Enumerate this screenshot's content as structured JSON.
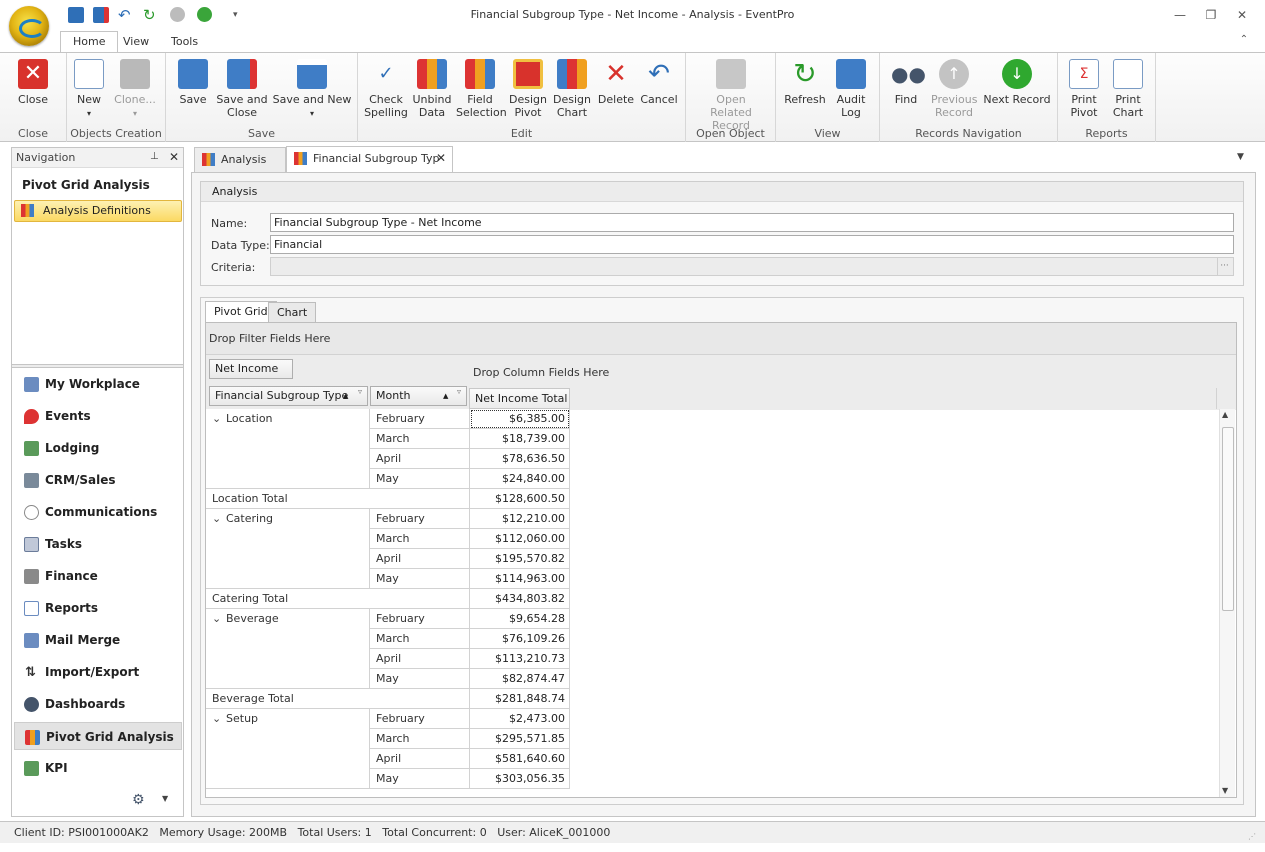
{
  "window": {
    "title": "Financial Subgroup Type - Net Income - Analysis - EventPro"
  },
  "ribbon_tabs": [
    "Home",
    "View",
    "Tools"
  ],
  "ribbon_groups": [
    {
      "name": "Close",
      "buttons": [
        "Close"
      ]
    },
    {
      "name": "Objects Creation",
      "buttons": [
        "New",
        "Clone..."
      ]
    },
    {
      "name": "Save",
      "buttons": [
        "Save",
        "Save and Close",
        "Save and New"
      ]
    },
    {
      "name": "Edit",
      "buttons": [
        "Check Spelling",
        "Unbind Data",
        "Field Selection",
        "Design Pivot",
        "Design Chart",
        "Delete",
        "Cancel"
      ]
    },
    {
      "name": "Open Object",
      "buttons": [
        "Open Related Record"
      ]
    },
    {
      "name": "View",
      "buttons": [
        "Refresh",
        "Audit Log"
      ]
    },
    {
      "name": "Records Navigation",
      "buttons": [
        "Find",
        "Previous Record",
        "Next Record"
      ]
    },
    {
      "name": "Reports",
      "buttons": [
        "Print Pivot",
        "Print Chart"
      ]
    }
  ],
  "navigation": {
    "header": "Navigation",
    "section_title": "Pivot Grid Analysis",
    "selected_item": "Analysis Definitions",
    "modules": [
      "My Workplace",
      "Events",
      "Lodging",
      "CRM/Sales",
      "Communications",
      "Tasks",
      "Finance",
      "Reports",
      "Mail Merge",
      "Import/Export",
      "Dashboards",
      "Pivot Grid Analysis",
      "KPI"
    ]
  },
  "doc_tabs": [
    "Analysis",
    "Financial Subgroup Typ"
  ],
  "analysis": {
    "section": "Analysis",
    "name_label": "Name:",
    "name_value": "Financial Subgroup Type - Net Income",
    "datatype_label": "Data Type:",
    "datatype_value": "Financial",
    "criteria_label": "Criteria:",
    "criteria_btn": "···"
  },
  "pivot": {
    "tabs": [
      "Pivot Grid",
      "Chart"
    ],
    "filter_area": "Drop Filter Fields Here",
    "data_field": "Net Income",
    "column_area": "Drop Column Fields Here",
    "row_fields": [
      "Financial Subgroup Type",
      "Month"
    ],
    "value_header": "Net Income Total",
    "groups": [
      {
        "name": "Location",
        "rows": [
          [
            "February",
            "$6,385.00"
          ],
          [
            "March",
            "$18,739.00"
          ],
          [
            "April",
            "$78,636.50"
          ],
          [
            "May",
            "$24,840.00"
          ]
        ],
        "total_label": "Location Total",
        "total": "$128,600.50"
      },
      {
        "name": "Catering",
        "rows": [
          [
            "February",
            "$12,210.00"
          ],
          [
            "March",
            "$112,060.00"
          ],
          [
            "April",
            "$195,570.82"
          ],
          [
            "May",
            "$114,963.00"
          ]
        ],
        "total_label": "Catering Total",
        "total": "$434,803.82"
      },
      {
        "name": "Beverage",
        "rows": [
          [
            "February",
            "$9,654.28"
          ],
          [
            "March",
            "$76,109.26"
          ],
          [
            "April",
            "$113,210.73"
          ],
          [
            "May",
            "$82,874.47"
          ]
        ],
        "total_label": "Beverage Total",
        "total": "$281,848.74"
      },
      {
        "name": "Setup",
        "rows": [
          [
            "February",
            "$2,473.00"
          ],
          [
            "March",
            "$295,571.85"
          ],
          [
            "April",
            "$581,640.60"
          ],
          [
            "May",
            "$303,056.35"
          ]
        ],
        "total_label": "",
        "total": ""
      }
    ]
  },
  "status": "Client ID: PSI001000AK2   Memory Usage: 200MB   Total Users: 1   Total Concurrent: 0   User: AliceK_001000"
}
